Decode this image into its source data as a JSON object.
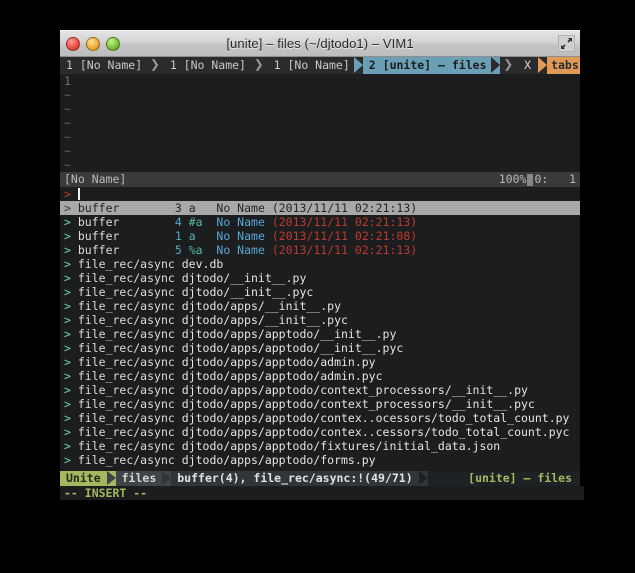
{
  "window": {
    "title": "[unite] – files (~/djtodo1) – VIM1",
    "controls": [
      "close",
      "minimize",
      "zoom"
    ],
    "fullscreen_icon": "fullscreen-arrows-icon"
  },
  "tabline": {
    "tabs": [
      {
        "label": "1 [No Name]",
        "active": false
      },
      {
        "label": "1 [No Name]",
        "active": false
      },
      {
        "label": "1 [No Name]",
        "active": false
      },
      {
        "label": "2 [unite] – files",
        "active": true
      }
    ],
    "close_label": "X",
    "tabs_label": "tabs"
  },
  "editor": {
    "first_line_number": "1",
    "filler_rows": [
      "~",
      "~",
      "~",
      "~",
      "~",
      "~"
    ],
    "statusline": {
      "name": "[No Name]",
      "percent": "100%",
      "position": "0:   1"
    }
  },
  "unite": {
    "prompt_mark": ">",
    "prompt_value": "",
    "buffers": [
      {
        "marker": ">",
        "kind": "buffer",
        "number": "3",
        "flags": "a",
        "name": "No Name",
        "date": "(2013/11/11 02:21:13)",
        "selected": true
      },
      {
        "marker": ">",
        "kind": "buffer",
        "number": "4",
        "flags": "#a",
        "name": "No Name",
        "date": "(2013/11/11 02:21:13)",
        "selected": false
      },
      {
        "marker": ">",
        "kind": "buffer",
        "number": "1",
        "flags": "a",
        "name": "No Name",
        "date": "(2013/11/11 02:21:08)",
        "selected": false
      },
      {
        "marker": ">",
        "kind": "buffer",
        "number": "5",
        "flags": "%a",
        "name": "No Name",
        "date": "(2013/11/11 02:21:13)",
        "selected": false
      }
    ],
    "files": [
      {
        "marker": ">",
        "source": "file_rec/async",
        "path": "dev.db"
      },
      {
        "marker": ">",
        "source": "file_rec/async",
        "path": "djtodo/__init__.py"
      },
      {
        "marker": ">",
        "source": "file_rec/async",
        "path": "djtodo/__init__.pyc"
      },
      {
        "marker": ">",
        "source": "file_rec/async",
        "path": "djtodo/apps/__init__.py"
      },
      {
        "marker": ">",
        "source": "file_rec/async",
        "path": "djtodo/apps/__init__.pyc"
      },
      {
        "marker": ">",
        "source": "file_rec/async",
        "path": "djtodo/apps/apptodo/__init__.py"
      },
      {
        "marker": ">",
        "source": "file_rec/async",
        "path": "djtodo/apps/apptodo/__init__.pyc"
      },
      {
        "marker": ">",
        "source": "file_rec/async",
        "path": "djtodo/apps/apptodo/admin.py"
      },
      {
        "marker": ">",
        "source": "file_rec/async",
        "path": "djtodo/apps/apptodo/admin.pyc"
      },
      {
        "marker": ">",
        "source": "file_rec/async",
        "path": "djtodo/apps/apptodo/context_processors/__init__.py"
      },
      {
        "marker": ">",
        "source": "file_rec/async",
        "path": "djtodo/apps/apptodo/context_processors/__init__.pyc"
      },
      {
        "marker": ">",
        "source": "file_rec/async",
        "path": "djtodo/apps/apptodo/contex..ocessors/todo_total_count.py"
      },
      {
        "marker": ">",
        "source": "file_rec/async",
        "path": "djtodo/apps/apptodo/contex..cessors/todo_total_count.pyc"
      },
      {
        "marker": ">",
        "source": "file_rec/async",
        "path": "djtodo/apps/apptodo/fixtures/initial_data.json"
      },
      {
        "marker": ">",
        "source": "file_rec/async",
        "path": "djtodo/apps/apptodo/forms.py"
      }
    ],
    "statusline": {
      "badge": "Unite",
      "profile": "files",
      "context": "buffer(4), file_rec/async:!(49/71)",
      "right": "[unite] – files"
    }
  },
  "mode": {
    "text": "-- INSERT --"
  },
  "colors": {
    "accent_tab_active": "#6a9fb5",
    "accent_tabs_label": "#e09a55",
    "accent_unite_badge": "#a5b85f",
    "marker": "#6ecfb0",
    "date": "#c0392b",
    "bufnum": "#51a7c6"
  }
}
